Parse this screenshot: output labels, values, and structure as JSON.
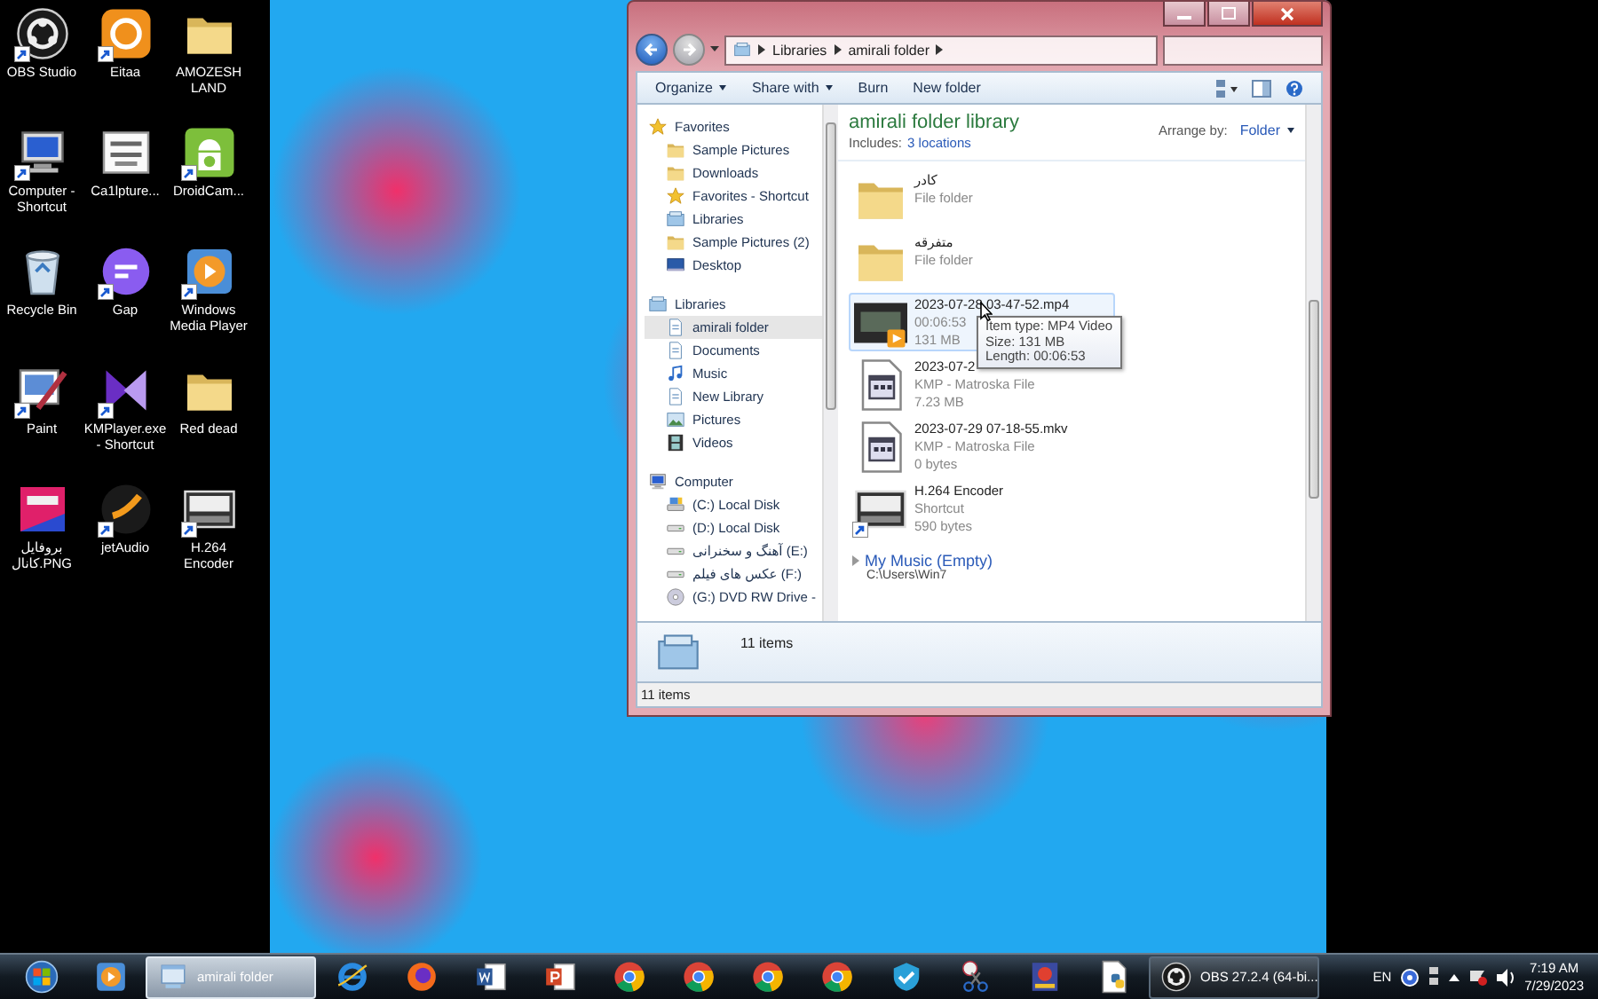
{
  "desktop_icons": [
    {
      "label": "OBS Studio",
      "kind": "obs",
      "shortcut": true
    },
    {
      "label": "Eitaa",
      "kind": "eitaa",
      "shortcut": true
    },
    {
      "label": "AMOZESH LAND",
      "kind": "folder",
      "shortcut": false
    },
    {
      "label": "Computer - Shortcut",
      "kind": "computer",
      "shortcut": true
    },
    {
      "label": "Ca1lpture...",
      "kind": "capture",
      "shortcut": false
    },
    {
      "label": "DroidCam...",
      "kind": "droidcam",
      "shortcut": true
    },
    {
      "label": "Recycle Bin",
      "kind": "recycle",
      "shortcut": false
    },
    {
      "label": "Gap",
      "kind": "gap",
      "shortcut": true
    },
    {
      "label": "Windows Media Player",
      "kind": "wmp",
      "shortcut": true
    },
    {
      "label": "Paint",
      "kind": "paint",
      "shortcut": true
    },
    {
      "label": "KMPlayer.exe - Shortcut",
      "kind": "kmplayer",
      "shortcut": true
    },
    {
      "label": "Red dead",
      "kind": "folder",
      "shortcut": false
    },
    {
      "label": "بروفایل کانال.PNG",
      "kind": "image",
      "shortcut": false
    },
    {
      "label": "jetAudio",
      "kind": "jetaudio",
      "shortcut": true
    },
    {
      "label": "H.264 Encoder",
      "kind": "h264",
      "shortcut": true
    }
  ],
  "explorer": {
    "address": [
      "Libraries",
      "amirali folder"
    ],
    "toolbar": [
      {
        "label": "Organize",
        "dropdown": true
      },
      {
        "label": "Share with",
        "dropdown": true
      },
      {
        "label": "Burn",
        "dropdown": false
      },
      {
        "label": "New folder",
        "dropdown": false
      }
    ],
    "nav": [
      {
        "label": "Favorites",
        "kind": "star",
        "selected": false,
        "children": [
          {
            "label": "Sample Pictures",
            "kind": "folder",
            "selected": false
          },
          {
            "label": "Downloads",
            "kind": "folder",
            "selected": false
          },
          {
            "label": "Favorites - Shortcut",
            "kind": "star",
            "selected": false
          },
          {
            "label": "Libraries",
            "kind": "library",
            "selected": false
          },
          {
            "label": "Sample Pictures (2)",
            "kind": "folder",
            "selected": false
          },
          {
            "label": "Desktop",
            "kind": "desktop",
            "selected": false
          }
        ]
      },
      {
        "label": "Libraries",
        "kind": "library",
        "selected": false,
        "children": [
          {
            "label": "amirali folder",
            "kind": "doc",
            "selected": true
          },
          {
            "label": "Documents",
            "kind": "doc",
            "selected": false
          },
          {
            "label": "Music",
            "kind": "music",
            "selected": false
          },
          {
            "label": "New Library",
            "kind": "doc",
            "selected": false
          },
          {
            "label": "Pictures",
            "kind": "picture",
            "selected": false
          },
          {
            "label": "Videos",
            "kind": "film",
            "selected": false
          }
        ]
      },
      {
        "label": "Computer",
        "kind": "computer",
        "selected": false,
        "children": [
          {
            "label": "(C:) Local Disk",
            "kind": "sysdisk",
            "selected": false
          },
          {
            "label": "(D:) Local Disk",
            "kind": "disk",
            "selected": false
          },
          {
            "label": "آهنگ و سخنرانی (E:)",
            "kind": "disk",
            "selected": false
          },
          {
            "label": "عکس های فیلم (F:)",
            "kind": "disk",
            "selected": false
          },
          {
            "label": "(G:) DVD RW Drive -",
            "kind": "dvd",
            "selected": false
          }
        ]
      }
    ],
    "library": {
      "title": "amirali folder library",
      "includes_label": "Includes:",
      "includes_link": "3 locations",
      "arrange_label": "Arrange by:",
      "arrange_value": "Folder"
    },
    "items": [
      {
        "name": "کادر",
        "type": "File folder",
        "kind": "folder",
        "selected": false
      },
      {
        "name": "متفرقه",
        "type": "File folder",
        "kind": "folder",
        "selected": false
      },
      {
        "name": "2023-07-28 03-47-52.mp4",
        "type": "00:06:53",
        "size": "131 MB",
        "kind": "video",
        "selected": true
      },
      {
        "name": "2023-07-2",
        "type": "KMP - Matroska File",
        "size": "7.23 MB",
        "kind": "mkv",
        "selected": false
      },
      {
        "name": "2023-07-29 07-18-55.mkv",
        "type": "KMP - Matroska File",
        "size": "0 bytes",
        "kind": "mkv",
        "selected": false
      },
      {
        "name": "H.264 Encoder",
        "type": "Shortcut",
        "size": "590 bytes",
        "kind": "h264",
        "selected": false
      }
    ],
    "tooltip": [
      "Item type: MP4 Video",
      "Size: 131 MB",
      "Length: 00:06:53"
    ],
    "group": {
      "title": "My Music (Empty)",
      "path": "C:\\Users\\Win7"
    },
    "details": "11 items",
    "status": "11 items"
  },
  "taskbar": {
    "items": [
      {
        "kind": "start",
        "selected": false
      },
      {
        "kind": "wmp",
        "selected": false
      },
      {
        "kind": "explorer",
        "label": "amirali folder",
        "selected": true
      },
      {
        "kind": "ie",
        "selected": false
      },
      {
        "kind": "firefox",
        "selected": false
      },
      {
        "kind": "word",
        "selected": false
      },
      {
        "kind": "powerpoint",
        "selected": false
      },
      {
        "kind": "chrome",
        "selected": false
      },
      {
        "kind": "chrome",
        "selected": false
      },
      {
        "kind": "chrome",
        "selected": false
      },
      {
        "kind": "chrome",
        "selected": false
      },
      {
        "kind": "shield",
        "selected": false
      },
      {
        "kind": "snip",
        "selected": false
      },
      {
        "kind": "game",
        "selected": false
      },
      {
        "kind": "python",
        "selected": false
      },
      {
        "kind": "obs",
        "label": "OBS 27.2.4 (64-bi...",
        "selected": false
      }
    ],
    "language": "EN",
    "time": "7:19 AM",
    "date": "7/29/2023"
  }
}
